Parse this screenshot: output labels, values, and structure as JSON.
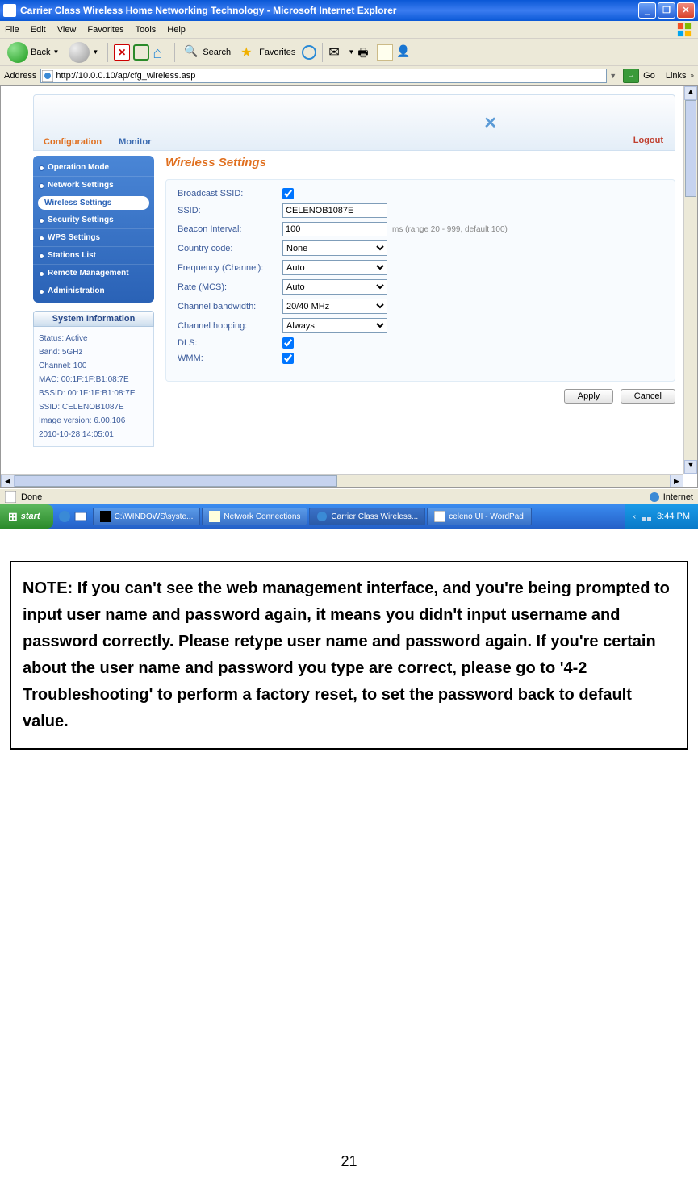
{
  "window": {
    "title": "Carrier Class Wireless Home Networking Technology - Microsoft Internet Explorer"
  },
  "menubar": {
    "file": "File",
    "edit": "Edit",
    "view": "View",
    "favorites": "Favorites",
    "tools": "Tools",
    "help": "Help"
  },
  "toolbar": {
    "back": "Back",
    "search": "Search",
    "favorites": "Favorites"
  },
  "addressbar": {
    "label": "Address",
    "url": "http://10.0.0.10/ap/cfg_wireless.asp",
    "go": "Go",
    "links": "Links"
  },
  "router": {
    "tabs": {
      "config": "Configuration",
      "monitor": "Monitor"
    },
    "logout": "Logout",
    "nav": {
      "op": "Operation Mode",
      "net": "Network Settings",
      "wireless": "Wireless Settings",
      "sec": "Security Settings",
      "wps": "WPS Settings",
      "sta": "Stations List",
      "remote": "Remote Management",
      "admin": "Administration"
    },
    "sysinfo": {
      "title": "System Information",
      "status": "Status: Active",
      "band": "Band: 5GHz",
      "channel": "Channel: 100",
      "mac": "MAC: 00:1F:1F:B1:08:7E",
      "bssid": "BSSID: 00:1F:1F:B1:08:7E",
      "ssid": "SSID: CELENOB1087E",
      "img": "Image version: 6.00.106",
      "date": "2010-10-28 14:05:01"
    },
    "page_title": "Wireless Settings",
    "form": {
      "broadcast": "Broadcast SSID:",
      "ssid_lbl": "SSID:",
      "ssid_val": "CELENOB1087E",
      "beacon_lbl": "Beacon Interval:",
      "beacon_val": "100",
      "beacon_hint": "ms (range 20 - 999, default 100)",
      "country_lbl": "Country code:",
      "country_val": "None",
      "freq_lbl": "Frequency (Channel):",
      "freq_val": "Auto",
      "rate_lbl": "Rate (MCS):",
      "rate_val": "Auto",
      "bw_lbl": "Channel bandwidth:",
      "bw_val": "20/40 MHz",
      "hop_lbl": "Channel hopping:",
      "hop_val": "Always",
      "dls": "DLS:",
      "wmm": "WMM:"
    },
    "buttons": {
      "apply": "Apply",
      "cancel": "Cancel"
    }
  },
  "statusbar": {
    "done": "Done",
    "zone": "Internet"
  },
  "taskbar": {
    "start": "start",
    "task1": "C:\\WINDOWS\\syste...",
    "task2": "Network Connections",
    "task3": "Carrier Class Wireless...",
    "task4": "celeno UI - WordPad",
    "clock": "3:44 PM"
  },
  "note": "NOTE: If you can't see the web management interface, and you're being prompted to input user name and password again, it means you didn't input username and password correctly. Please retype user name and password again. If you're certain about the user name and password you type are correct, please go to '4-2 Troubleshooting' to perform a factory reset, to set the password back to default value.",
  "page_number": "21"
}
